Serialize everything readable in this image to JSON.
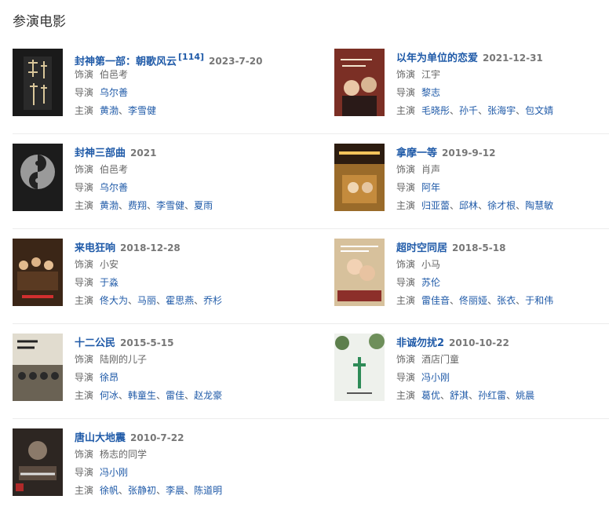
{
  "section_title": "参演电影",
  "labels": {
    "role": "饰演",
    "director": "导演",
    "cast": "主演"
  },
  "separator": "、",
  "movies": [
    {
      "title": "封神第一部：朝歌风云",
      "cite": "[114]",
      "date": "2023-7-20",
      "role": "伯邑考",
      "director": [
        "乌尔善"
      ],
      "cast": [
        "黄渤",
        "李雪健"
      ],
      "poster_color": "#1a1a1a"
    },
    {
      "title": "以年为单位的恋爱",
      "date": "2021-12-31",
      "role": "江宇",
      "director": [
        "黎志"
      ],
      "cast": [
        "毛晓彤",
        "孙千",
        "张海宇",
        "包文婧"
      ],
      "poster_color": "#6b2a22"
    },
    {
      "title": "封神三部曲",
      "date": "2021",
      "role": "伯邑考",
      "director": [
        "乌尔善"
      ],
      "cast": [
        "黄渤",
        "费翔",
        "李雪健",
        "夏雨"
      ],
      "poster_color": "#2b2b2b"
    },
    {
      "title": "拿摩一等",
      "date": "2019-9-12",
      "role": "肖声",
      "director": [
        "阿年"
      ],
      "cast": [
        "归亚蕾",
        "邱林",
        "徐才根",
        "陶慧敏"
      ],
      "poster_color": "#8a5a1c"
    },
    {
      "title": "来电狂响",
      "date": "2018-12-28",
      "role": "小安",
      "director": [
        "于淼"
      ],
      "cast": [
        "佟大为",
        "马丽",
        "霍思燕",
        "乔杉"
      ],
      "poster_color": "#3a2416"
    },
    {
      "title": "超时空同居",
      "date": "2018-5-18",
      "role": "小马",
      "director": [
        "苏伦"
      ],
      "cast": [
        "雷佳音",
        "佟丽娅",
        "张衣",
        "于和伟"
      ],
      "poster_color": "#c9b28a"
    },
    {
      "title": "十二公民",
      "date": "2015-5-15",
      "role": "陆刚的儿子",
      "director": [
        "徐昂"
      ],
      "cast": [
        "何冰",
        "韩童生",
        "雷佳",
        "赵龙豪"
      ],
      "poster_color": "#d8d2c4"
    },
    {
      "title": "非诚勿扰2",
      "date": "2010-10-22",
      "role": "酒店门童",
      "director": [
        "冯小刚"
      ],
      "cast": [
        "葛优",
        "舒淇",
        "孙红雷",
        "姚晨"
      ],
      "poster_color": "#e8ece6"
    },
    {
      "title": "唐山大地震",
      "date": "2010-7-22",
      "role": "杨志的同学",
      "director": [
        "冯小刚"
      ],
      "cast": [
        "徐帆",
        "张静初",
        "李晨",
        "陈道明"
      ],
      "poster_color": "#3d3530"
    }
  ]
}
